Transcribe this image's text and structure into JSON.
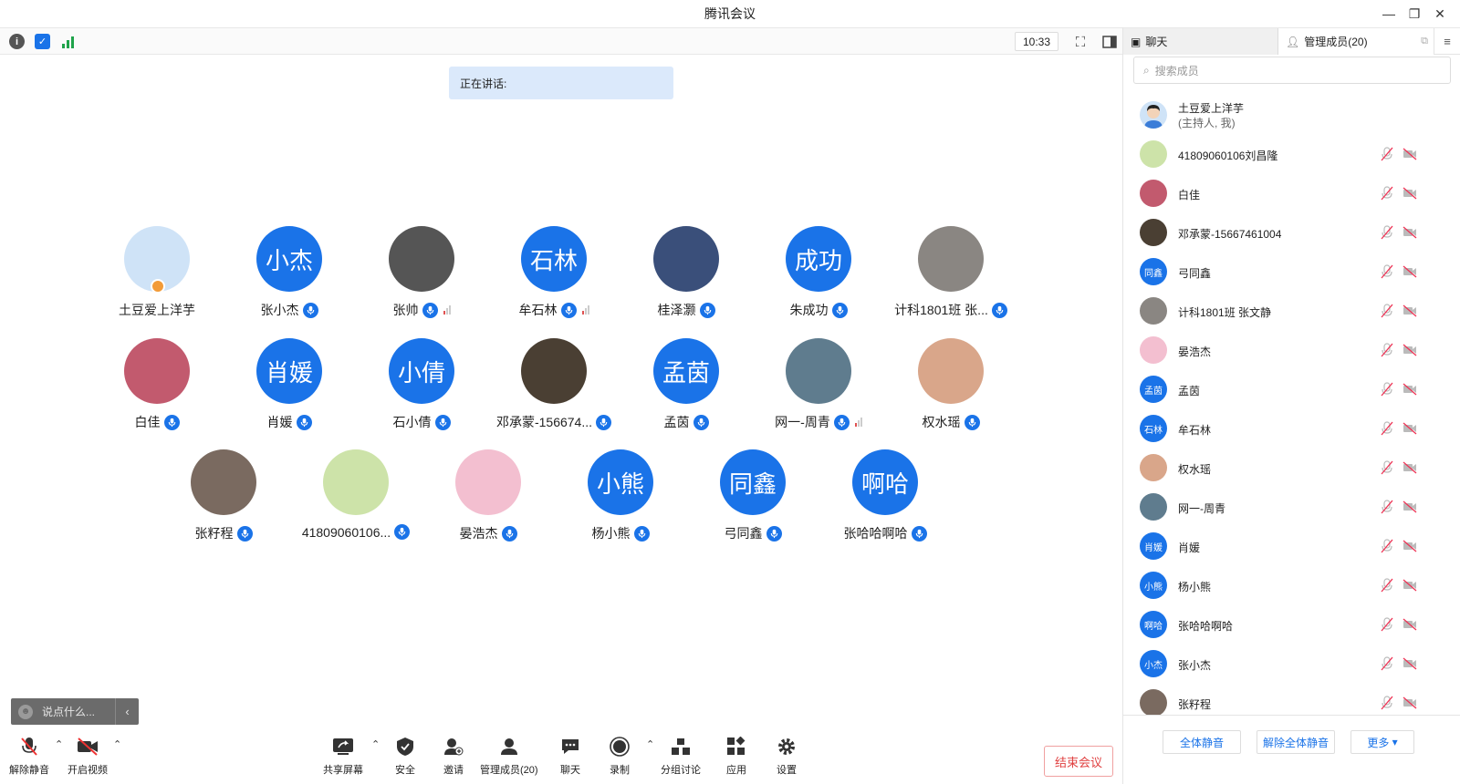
{
  "window": {
    "title": "腾讯会议"
  },
  "topbar": {
    "clock": "10:33"
  },
  "main": {
    "speaking_label": "正在讲话:"
  },
  "participants": [
    {
      "name": "土豆爱上洋芋",
      "avatar_text": "",
      "avatar_color": "#cfe3f7",
      "host": true,
      "mic": false,
      "signal": ""
    },
    {
      "name": "张小杰",
      "avatar_text": "小杰",
      "avatar_color": "#1a73e8",
      "host": false,
      "mic": true,
      "signal": ""
    },
    {
      "name": "张帅",
      "avatar_text": "",
      "avatar_color": "#555555",
      "host": false,
      "mic": true,
      "signal": "red"
    },
    {
      "name": "牟石林",
      "avatar_text": "石林",
      "avatar_color": "#1a73e8",
      "host": false,
      "mic": true,
      "signal": "red"
    },
    {
      "name": "桂泽灏",
      "avatar_text": "",
      "avatar_color": "#3a4f7a",
      "host": false,
      "mic": true,
      "signal": ""
    },
    {
      "name": "朱成功",
      "avatar_text": "成功",
      "avatar_color": "#1a73e8",
      "host": false,
      "mic": true,
      "signal": ""
    },
    {
      "name": "计科1801班 张...",
      "avatar_text": "",
      "avatar_color": "#8a8682",
      "host": false,
      "mic": true,
      "signal": ""
    },
    {
      "name": "白佳",
      "avatar_text": "",
      "avatar_color": "#c25a6e",
      "host": false,
      "mic": true,
      "signal": ""
    },
    {
      "name": "肖媛",
      "avatar_text": "肖媛",
      "avatar_color": "#1a73e8",
      "host": false,
      "mic": true,
      "signal": ""
    },
    {
      "name": "石小倩",
      "avatar_text": "小倩",
      "avatar_color": "#1a73e8",
      "host": false,
      "mic": true,
      "signal": ""
    },
    {
      "name": "邓承蒙-156674...",
      "avatar_text": "",
      "avatar_color": "#4a3f33",
      "host": false,
      "mic": true,
      "signal": ""
    },
    {
      "name": "孟茵",
      "avatar_text": "孟茵",
      "avatar_color": "#1a73e8",
      "host": false,
      "mic": true,
      "signal": ""
    },
    {
      "name": "网一-周青",
      "avatar_text": "",
      "avatar_color": "#5f7c8e",
      "host": false,
      "mic": true,
      "signal": "red"
    },
    {
      "name": "权水瑶",
      "avatar_text": "",
      "avatar_color": "#d9a68a",
      "host": false,
      "mic": true,
      "signal": ""
    },
    {
      "name": "张籽程",
      "avatar_text": "",
      "avatar_color": "#7a6a60",
      "host": false,
      "mic": true,
      "signal": ""
    },
    {
      "name": "41809060106...",
      "avatar_text": "",
      "avatar_color": "#cde3a9",
      "host": false,
      "mic": true,
      "signal": ""
    },
    {
      "name": "晏浩杰",
      "avatar_text": "",
      "avatar_color": "#f3bfd0",
      "host": false,
      "mic": true,
      "signal": ""
    },
    {
      "name": "杨小熊",
      "avatar_text": "小熊",
      "avatar_color": "#1a73e8",
      "host": false,
      "mic": true,
      "signal": ""
    },
    {
      "name": "弓同鑫",
      "avatar_text": "同鑫",
      "avatar_color": "#1a73e8",
      "host": false,
      "mic": true,
      "signal": ""
    },
    {
      "name": "张哈哈啊哈",
      "avatar_text": "啊哈",
      "avatar_color": "#1a73e8",
      "host": false,
      "mic": true,
      "signal": ""
    }
  ],
  "chat_input": {
    "placeholder": "说点什么..."
  },
  "bottombar": {
    "unmute": "解除静音",
    "video": "开启视频",
    "share": "共享屏幕",
    "security": "安全",
    "invite": "邀请",
    "manage": "管理成员(20)",
    "chat": "聊天",
    "record": "录制",
    "breakout": "分组讨论",
    "apps": "应用",
    "settings": "设置",
    "end": "结束会议"
  },
  "sidebar": {
    "tab_chat": "聊天",
    "tab_members": "管理成员(20)",
    "search_placeholder": "搜索成员",
    "host_name": "土豆爱上洋芋",
    "host_sub": "(主持人, 我)",
    "members": [
      {
        "name": "41809060106刘昌隆",
        "avatar_text": "",
        "color": "#cde3a9"
      },
      {
        "name": "白佳",
        "avatar_text": "",
        "color": "#c25a6e"
      },
      {
        "name": "邓承蒙-15667461004",
        "avatar_text": "",
        "color": "#4a3f33"
      },
      {
        "name": "弓同鑫",
        "avatar_text": "同鑫",
        "color": "#1a73e8"
      },
      {
        "name": "计科1801班 张文静",
        "avatar_text": "",
        "color": "#8a8682"
      },
      {
        "name": "晏浩杰",
        "avatar_text": "",
        "color": "#f3bfd0"
      },
      {
        "name": "孟茵",
        "avatar_text": "孟茵",
        "color": "#1a73e8"
      },
      {
        "name": "牟石林",
        "avatar_text": "石林",
        "color": "#1a73e8"
      },
      {
        "name": "权水瑶",
        "avatar_text": "",
        "color": "#d9a68a"
      },
      {
        "name": "网一-周青",
        "avatar_text": "",
        "color": "#5f7c8e"
      },
      {
        "name": "肖媛",
        "avatar_text": "肖媛",
        "color": "#1a73e8"
      },
      {
        "name": "杨小熊",
        "avatar_text": "小熊",
        "color": "#1a73e8"
      },
      {
        "name": "张哈哈啊哈",
        "avatar_text": "啊哈",
        "color": "#1a73e8"
      },
      {
        "name": "张小杰",
        "avatar_text": "小杰",
        "color": "#1a73e8"
      },
      {
        "name": "张籽程",
        "avatar_text": "",
        "color": "#7a6a60"
      }
    ],
    "mute_all": "全体静音",
    "unmute_all": "解除全体静音",
    "more": "更多"
  }
}
